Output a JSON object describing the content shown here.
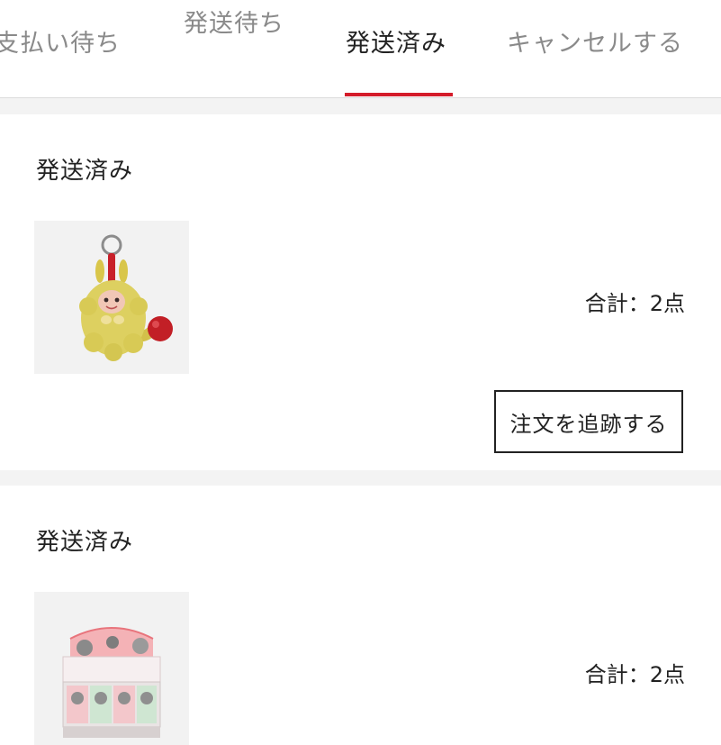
{
  "tabs": [
    {
      "label": "支払い待ち"
    },
    {
      "label": "発送待ち"
    },
    {
      "label": "発送済み"
    },
    {
      "label": "キャンセルする"
    }
  ],
  "active_tab": "発送済み",
  "orders": [
    {
      "status": "発送済み",
      "total": "合計：2点",
      "action_label": "注文を追跡する",
      "thumbnail": "plush-keychain-image"
    },
    {
      "status": "発送済み",
      "total": "合計：2点",
      "thumbnail": "blind-box-set-image"
    }
  ],
  "colors": {
    "accent": "#d41c2a",
    "text": "#222222",
    "muted_text": "#8a8a8a",
    "separator": "#f3f3f3"
  }
}
